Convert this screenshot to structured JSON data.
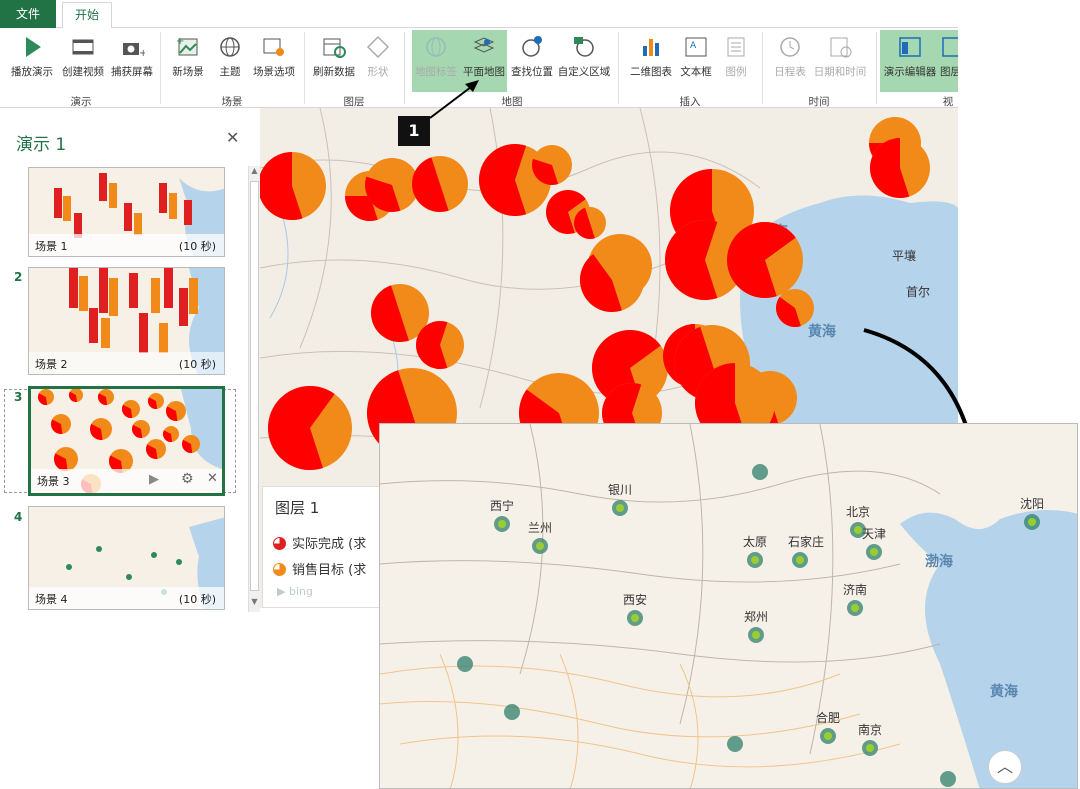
{
  "tabs": {
    "file": "文件",
    "home": "开始"
  },
  "ribbon": {
    "buttons": {
      "play": "播放演示",
      "create_video": "创建视频",
      "capture": "捕获屏幕",
      "new_scene": "新场景",
      "theme": "主题",
      "scene_options": "场景选项",
      "refresh": "刷新数据",
      "shape": "形状",
      "globe": "地图标签",
      "flat_map": "平面地图",
      "find": "查找位置",
      "custom_region": "自定义区域",
      "chart2d": "二维图表",
      "textbox": "文本框",
      "legend": "图例",
      "timeline": "日程表",
      "datetime": "日期和时间",
      "tour_editor": "演示编辑器",
      "layer_pane": "图层"
    },
    "groups": {
      "tour": "演示",
      "scene": "场景",
      "layer": "图层",
      "map": "地图",
      "insert": "插入",
      "time": "时间",
      "view": "视"
    }
  },
  "colors": {
    "accent": "#217346",
    "actual": "#ff0000",
    "target": "#f28a1a",
    "sea": "#b5d3ea"
  },
  "tour": {
    "title": "演示 1",
    "close": "✕",
    "scenes": [
      {
        "num": "",
        "name": "场景 1",
        "dur": "(10 秒)"
      },
      {
        "num": "2",
        "name": "场景 2",
        "dur": "(10 秒)"
      },
      {
        "num": "3",
        "name": "场景 3",
        "dur": ""
      },
      {
        "num": "4",
        "name": "场景 4",
        "dur": "(10 秒)"
      }
    ]
  },
  "callout": "1",
  "map": {
    "bohai": "渤海",
    "yellow_sea": "黄海",
    "placenames": [
      "平壤",
      "首尔"
    ]
  },
  "layer": {
    "title": "图层 1",
    "items": [
      "实际完成 (求",
      "销售目标 (求"
    ],
    "bing": "bing"
  },
  "inset": {
    "cities": [
      "银川",
      "西宁",
      "兰州",
      "太原",
      "石家庄",
      "北京",
      "天津",
      "沈阳",
      "济南",
      "西安",
      "郑州",
      "合肥",
      "南京"
    ],
    "bohai": "渤海",
    "yellow_sea": "黄海"
  }
}
